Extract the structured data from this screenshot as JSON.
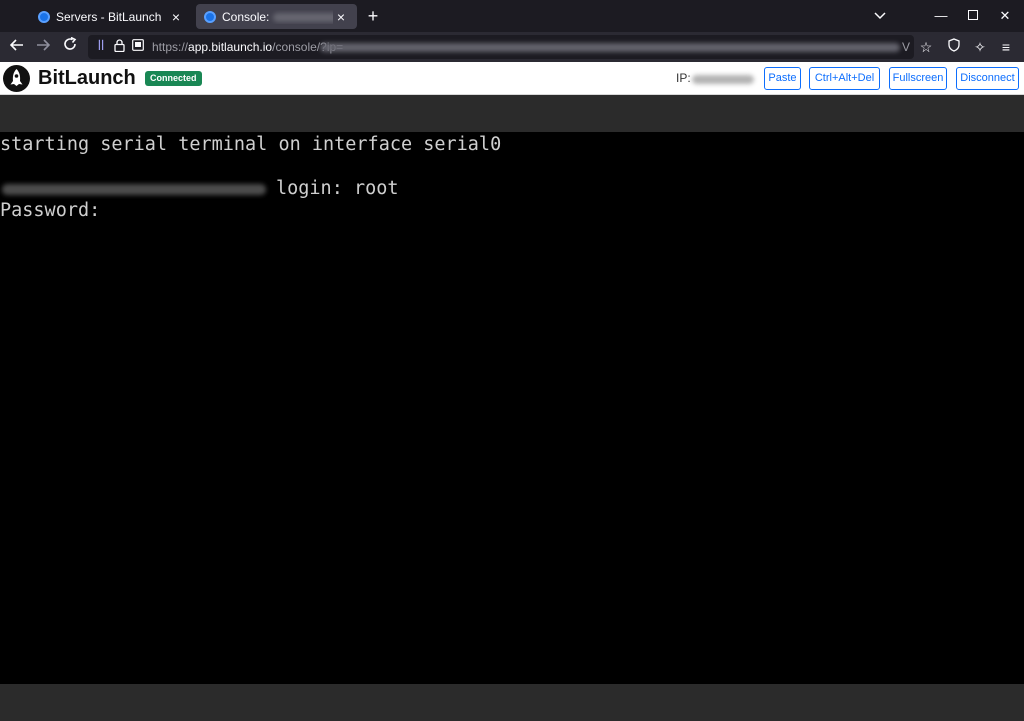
{
  "browser": {
    "tabs": [
      {
        "title": "Servers - BitLaunch",
        "active": false
      },
      {
        "title": "Console:",
        "active": true
      }
    ],
    "new_tab_label": "+",
    "url": {
      "scheme": "https://",
      "host": "app.bitlaunch.io",
      "path": "/console/?ip=",
      "tail": "V"
    }
  },
  "icons": {
    "back": "back-arrow-icon",
    "forward": "forward-arrow-icon",
    "reload": "reload-icon",
    "bookmark": "star-icon",
    "shield": "shield-icon",
    "extension": "extension-icon",
    "menu": "hamburger-menu-icon"
  },
  "app": {
    "brand": "BitLaunch",
    "status": "Connected",
    "status_color": "#198754",
    "ip_label": "IP:",
    "buttons": {
      "paste": "Paste",
      "ctrl_alt_del": "Ctrl+Alt+Del",
      "fullscreen": "Fullscreen",
      "disconnect": "Disconnect"
    },
    "accent_color": "#0d6efd"
  },
  "terminal": {
    "line1": "starting serial terminal on interface serial0",
    "line2": "login: root",
    "line3": "Password:"
  }
}
